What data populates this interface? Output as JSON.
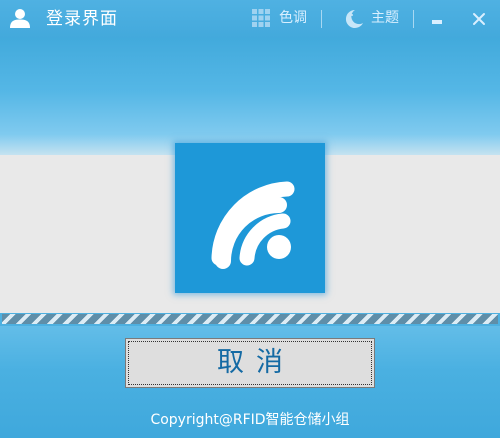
{
  "window": {
    "title": "登录界面",
    "title_icon": "user-icon"
  },
  "titlebar": {
    "color_label": "色调",
    "color_icon": "grid-icon",
    "theme_label": "主题",
    "theme_icon": "moon-icon",
    "minimize_icon": "minimize-icon",
    "close_icon": "close-icon"
  },
  "main": {
    "logo_icon": "wifi-signal-icon",
    "progress_fraction": 1.0,
    "cancel_label": "取消",
    "copyright": "Copyright@RFID智能仓储小组"
  },
  "colors": {
    "titlebar": "#43a9dc",
    "logo_tile": "#1e98d8",
    "button_text": "#146aa4",
    "band": "#e9e9e9"
  }
}
